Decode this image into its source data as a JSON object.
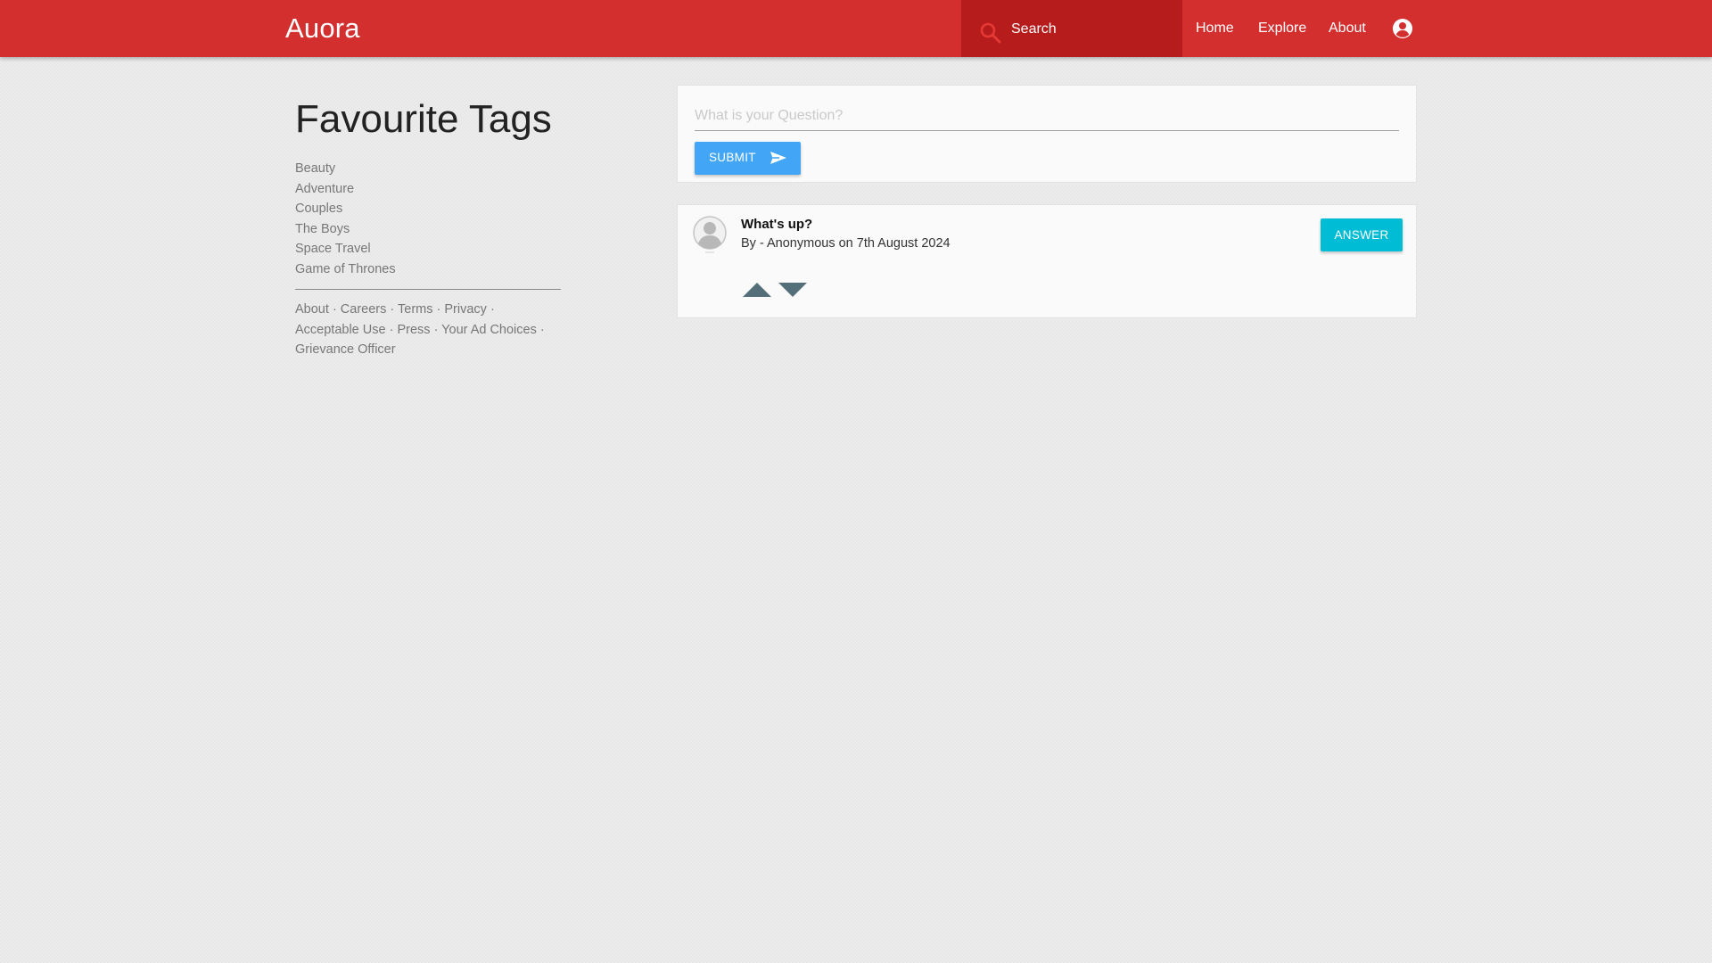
{
  "app": {
    "brand": "Auora"
  },
  "header": {
    "search_label": "Search",
    "nav": [
      {
        "label": "Home"
      },
      {
        "label": "Explore"
      },
      {
        "label": "About"
      }
    ],
    "icons": {
      "search": "search-icon",
      "account": "account-circle-icon"
    },
    "colors": {
      "bar": "#d32f2f",
      "search_bg": "#b71c1c"
    }
  },
  "sidebar": {
    "title": "Favourite Tags",
    "tags": [
      "Beauty",
      "Adventure",
      "Couples",
      "The Boys",
      "Space Travel",
      "Game of Thrones"
    ],
    "footer_links": [
      "About",
      "Careers",
      "Terms",
      "Privacy",
      "Acceptable Use",
      "Press",
      "Your Ad Choices",
      "Grievance Officer"
    ]
  },
  "ask": {
    "placeholder": "What is your Question?",
    "value": "",
    "submit_label": "SUBMIT",
    "submit_color": "#42a5f5"
  },
  "question": {
    "title": "What's up?",
    "meta": "By - Anonymous on 7th August 2024",
    "answer_label": "ANSWER",
    "answer_color": "#00bcd4",
    "icons": {
      "avatar": "avatar-icon",
      "upvote": "upvote-arrow-icon",
      "downvote": "downvote-arrow-icon"
    }
  }
}
